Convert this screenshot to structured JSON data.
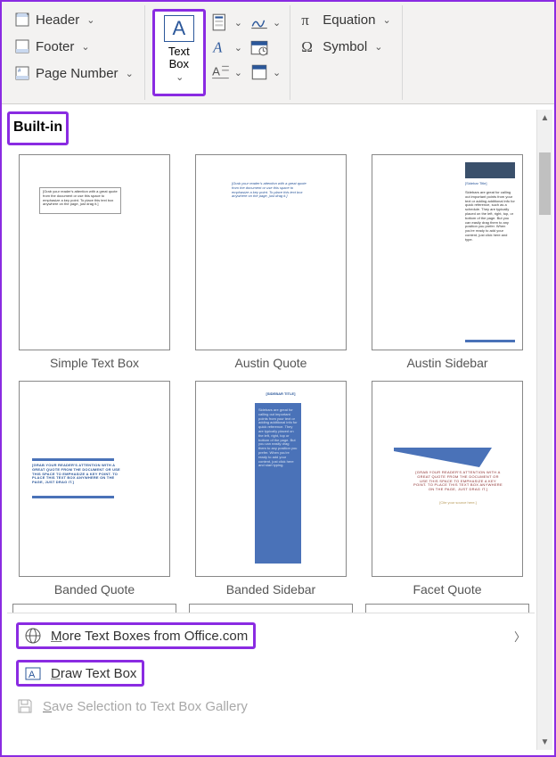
{
  "ribbon": {
    "header_label": "Header",
    "footer_label": "Footer",
    "page_number_label": "Page Number",
    "textbox_label": "Text\nBox",
    "equation_label": "Equation",
    "symbol_label": "Symbol"
  },
  "gallery": {
    "section_title": "Built-in",
    "items": [
      {
        "label": "Simple Text Box"
      },
      {
        "label": "Austin Quote"
      },
      {
        "label": "Austin Sidebar"
      },
      {
        "label": "Banded Quote"
      },
      {
        "label": "Banded Sidebar"
      },
      {
        "label": "Facet Quote"
      }
    ]
  },
  "menu": {
    "more_label": "More Text Boxes from Office.com",
    "draw_label": "Draw Text Box",
    "save_label": "Save Selection to Text Box Gallery"
  }
}
